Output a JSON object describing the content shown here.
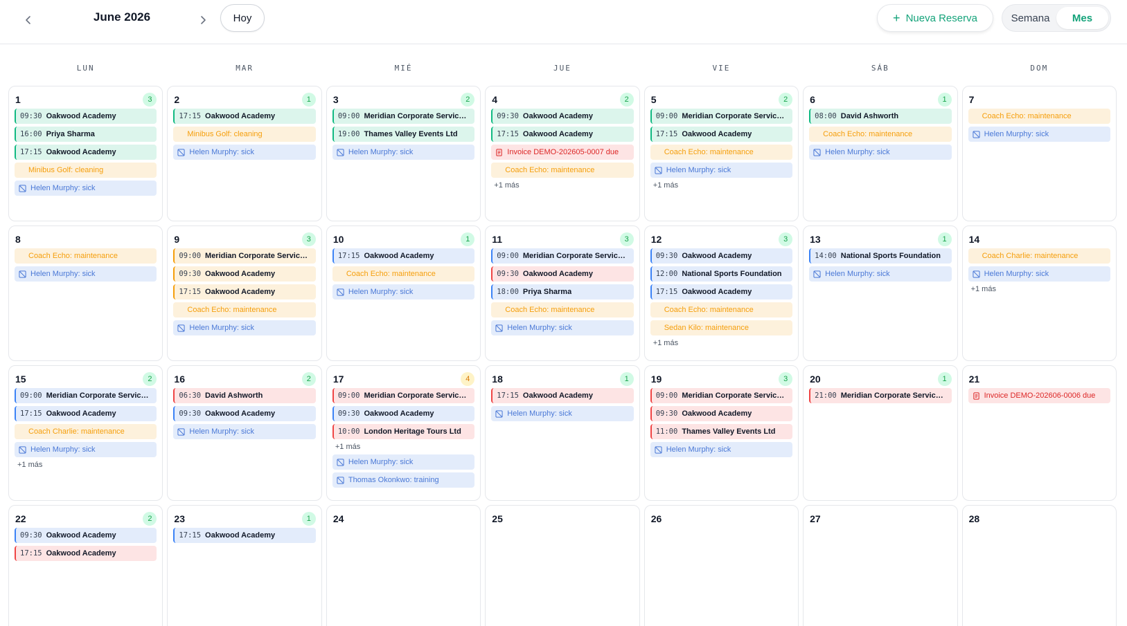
{
  "header": {
    "month_title": "June 2026",
    "today_label": "Hoy",
    "new_booking_label": "Nueva Reserva",
    "view_week_label": "Semana",
    "view_month_label": "Mes",
    "active_view": "Mes"
  },
  "colors": {
    "accent": "#14a37a",
    "booking_green": "#10b981",
    "booking_blue": "#3b82f6",
    "booking_amber": "#f59e0b",
    "booking_red": "#ef4444",
    "maintenance": "#f59e0b",
    "sick": "#4a78d6",
    "invoice": "#dc2626"
  },
  "weekdays": [
    "LUN",
    "MAR",
    "MIÉ",
    "JUE",
    "VIE",
    "SÁB",
    "DOM"
  ],
  "days": [
    {
      "day": "1",
      "count": "3",
      "count_color": "green",
      "events": [
        {
          "kind": "booking",
          "color": "green",
          "time": "09:30",
          "title": "Oakwood Academy"
        },
        {
          "kind": "booking",
          "color": "green",
          "time": "16:00",
          "title": "Priya Sharma"
        },
        {
          "kind": "booking",
          "color": "green",
          "time": "17:15",
          "title": "Oakwood Academy"
        },
        {
          "kind": "maintenance",
          "text": "Minibus Golf: cleaning"
        },
        {
          "kind": "sick",
          "text": "Helen Murphy: sick"
        }
      ]
    },
    {
      "day": "2",
      "count": "1",
      "count_color": "green",
      "events": [
        {
          "kind": "booking",
          "color": "green",
          "time": "17:15",
          "title": "Oakwood Academy"
        },
        {
          "kind": "maintenance",
          "text": "Minibus Golf: cleaning"
        },
        {
          "kind": "sick",
          "text": "Helen Murphy: sick"
        }
      ]
    },
    {
      "day": "3",
      "count": "2",
      "count_color": "green",
      "events": [
        {
          "kind": "booking",
          "color": "green",
          "time": "09:00",
          "title": "Meridian Corporate Services Ltd"
        },
        {
          "kind": "booking",
          "color": "green",
          "time": "19:00",
          "title": "Thames Valley Events Ltd"
        },
        {
          "kind": "sick",
          "text": "Helen Murphy: sick"
        }
      ]
    },
    {
      "day": "4",
      "count": "2",
      "count_color": "green",
      "events": [
        {
          "kind": "booking",
          "color": "green",
          "time": "09:30",
          "title": "Oakwood Academy"
        },
        {
          "kind": "booking",
          "color": "green",
          "time": "17:15",
          "title": "Oakwood Academy"
        },
        {
          "kind": "invoice",
          "text": "Invoice DEMO-202605-0007 due"
        },
        {
          "kind": "maintenance",
          "text": "Coach Echo: maintenance"
        }
      ],
      "more": "+1 más"
    },
    {
      "day": "5",
      "count": "2",
      "count_color": "green",
      "events": [
        {
          "kind": "booking",
          "color": "green",
          "time": "09:00",
          "title": "Meridian Corporate Services Ltd"
        },
        {
          "kind": "booking",
          "color": "green",
          "time": "17:15",
          "title": "Oakwood Academy"
        },
        {
          "kind": "maintenance",
          "text": "Coach Echo: maintenance"
        },
        {
          "kind": "sick",
          "text": "Helen Murphy: sick"
        }
      ],
      "more": "+1 más"
    },
    {
      "day": "6",
      "count": "1",
      "count_color": "green",
      "events": [
        {
          "kind": "booking",
          "color": "green",
          "time": "08:00",
          "title": "David Ashworth"
        },
        {
          "kind": "maintenance",
          "text": "Coach Echo: maintenance"
        },
        {
          "kind": "sick",
          "text": "Helen Murphy: sick"
        }
      ]
    },
    {
      "day": "7",
      "count": "",
      "events": [
        {
          "kind": "maintenance",
          "text": "Coach Echo: maintenance"
        },
        {
          "kind": "sick",
          "text": "Helen Murphy: sick"
        }
      ]
    },
    {
      "day": "8",
      "count": "",
      "events": [
        {
          "kind": "maintenance",
          "text": "Coach Echo: maintenance"
        },
        {
          "kind": "sick",
          "text": "Helen Murphy: sick"
        }
      ]
    },
    {
      "day": "9",
      "count": "3",
      "count_color": "green",
      "events": [
        {
          "kind": "booking",
          "color": "amber",
          "time": "09:00",
          "title": "Meridian Corporate Services Ltd"
        },
        {
          "kind": "booking",
          "color": "amber",
          "time": "09:30",
          "title": "Oakwood Academy"
        },
        {
          "kind": "booking",
          "color": "amber",
          "time": "17:15",
          "title": "Oakwood Academy"
        },
        {
          "kind": "maintenance",
          "text": "Coach Echo: maintenance"
        },
        {
          "kind": "sick",
          "text": "Helen Murphy: sick"
        }
      ]
    },
    {
      "day": "10",
      "count": "1",
      "count_color": "green",
      "events": [
        {
          "kind": "booking",
          "color": "blue",
          "time": "17:15",
          "title": "Oakwood Academy"
        },
        {
          "kind": "maintenance",
          "text": "Coach Echo: maintenance"
        },
        {
          "kind": "sick",
          "text": "Helen Murphy: sick"
        }
      ]
    },
    {
      "day": "11",
      "count": "3",
      "count_color": "green",
      "events": [
        {
          "kind": "booking",
          "color": "blue",
          "time": "09:00",
          "title": "Meridian Corporate Services Ltd"
        },
        {
          "kind": "booking",
          "color": "red",
          "time": "09:30",
          "title": "Oakwood Academy"
        },
        {
          "kind": "booking",
          "color": "blue",
          "time": "18:00",
          "title": "Priya Sharma"
        },
        {
          "kind": "maintenance",
          "text": "Coach Echo: maintenance"
        },
        {
          "kind": "sick",
          "text": "Helen Murphy: sick"
        }
      ]
    },
    {
      "day": "12",
      "count": "3",
      "count_color": "green",
      "events": [
        {
          "kind": "booking",
          "color": "blue",
          "time": "09:30",
          "title": "Oakwood Academy"
        },
        {
          "kind": "booking",
          "color": "blue",
          "time": "12:00",
          "title": "National Sports Foundation"
        },
        {
          "kind": "booking",
          "color": "blue",
          "time": "17:15",
          "title": "Oakwood Academy"
        },
        {
          "kind": "maintenance",
          "text": "Coach Echo: maintenance"
        },
        {
          "kind": "maintenance",
          "text": "Sedan Kilo: maintenance"
        }
      ],
      "more": "+1 más"
    },
    {
      "day": "13",
      "count": "1",
      "count_color": "green",
      "events": [
        {
          "kind": "booking",
          "color": "blue",
          "time": "14:00",
          "title": "National Sports Foundation"
        },
        {
          "kind": "sick",
          "text": "Helen Murphy: sick"
        }
      ]
    },
    {
      "day": "14",
      "count": "",
      "events": [
        {
          "kind": "maintenance",
          "text": "Coach Charlie: maintenance"
        },
        {
          "kind": "sick",
          "text": "Helen Murphy: sick"
        }
      ],
      "more": "+1 más"
    },
    {
      "day": "15",
      "count": "2",
      "count_color": "green",
      "events": [
        {
          "kind": "booking",
          "color": "blue",
          "time": "09:00",
          "title": "Meridian Corporate Services Ltd"
        },
        {
          "kind": "booking",
          "color": "blue",
          "time": "17:15",
          "title": "Oakwood Academy"
        },
        {
          "kind": "maintenance",
          "text": "Coach Charlie: maintenance"
        },
        {
          "kind": "sick",
          "text": "Helen Murphy: sick"
        }
      ],
      "more": "+1 más"
    },
    {
      "day": "16",
      "count": "2",
      "count_color": "green",
      "events": [
        {
          "kind": "booking",
          "color": "red",
          "time": "06:30",
          "title": "David Ashworth"
        },
        {
          "kind": "booking",
          "color": "blue",
          "time": "09:30",
          "title": "Oakwood Academy"
        },
        {
          "kind": "sick",
          "text": "Helen Murphy: sick"
        }
      ]
    },
    {
      "day": "17",
      "count": "4",
      "count_color": "amber",
      "events": [
        {
          "kind": "booking",
          "color": "red",
          "time": "09:00",
          "title": "Meridian Corporate Services Ltd"
        },
        {
          "kind": "booking",
          "color": "blue",
          "time": "09:30",
          "title": "Oakwood Academy"
        },
        {
          "kind": "booking",
          "color": "red",
          "time": "10:00",
          "title": "London Heritage Tours Ltd"
        },
        {
          "kind": "more",
          "text": "+1 más"
        },
        {
          "kind": "sick",
          "text": "Helen Murphy: sick"
        },
        {
          "kind": "sick",
          "text": "Thomas Okonkwo: training"
        }
      ]
    },
    {
      "day": "18",
      "count": "1",
      "count_color": "green",
      "events": [
        {
          "kind": "booking",
          "color": "red",
          "time": "17:15",
          "title": "Oakwood Academy"
        },
        {
          "kind": "sick",
          "text": "Helen Murphy: sick"
        }
      ]
    },
    {
      "day": "19",
      "count": "3",
      "count_color": "green",
      "events": [
        {
          "kind": "booking",
          "color": "red",
          "time": "09:00",
          "title": "Meridian Corporate Services Ltd"
        },
        {
          "kind": "booking",
          "color": "red",
          "time": "09:30",
          "title": "Oakwood Academy"
        },
        {
          "kind": "booking",
          "color": "red",
          "time": "11:00",
          "title": "Thames Valley Events Ltd"
        },
        {
          "kind": "sick",
          "text": "Helen Murphy: sick"
        }
      ]
    },
    {
      "day": "20",
      "count": "1",
      "count_color": "green",
      "events": [
        {
          "kind": "booking",
          "color": "red",
          "time": "21:00",
          "title": "Meridian Corporate Services Ltd"
        }
      ]
    },
    {
      "day": "21",
      "count": "",
      "events": [
        {
          "kind": "invoice",
          "text": "Invoice DEMO-202606-0006 due"
        }
      ]
    },
    {
      "day": "22",
      "count": "2",
      "count_color": "green",
      "events": [
        {
          "kind": "booking",
          "color": "blue",
          "time": "09:30",
          "title": "Oakwood Academy"
        },
        {
          "kind": "booking",
          "color": "red",
          "time": "17:15",
          "title": "Oakwood Academy"
        }
      ]
    },
    {
      "day": "23",
      "count": "1",
      "count_color": "green",
      "events": [
        {
          "kind": "booking",
          "color": "blue",
          "time": "17:15",
          "title": "Oakwood Academy"
        }
      ]
    },
    {
      "day": "24",
      "count": "",
      "events": []
    },
    {
      "day": "25",
      "count": "",
      "events": []
    },
    {
      "day": "26",
      "count": "",
      "events": []
    },
    {
      "day": "27",
      "count": "",
      "events": []
    },
    {
      "day": "28",
      "count": "",
      "events": []
    }
  ]
}
